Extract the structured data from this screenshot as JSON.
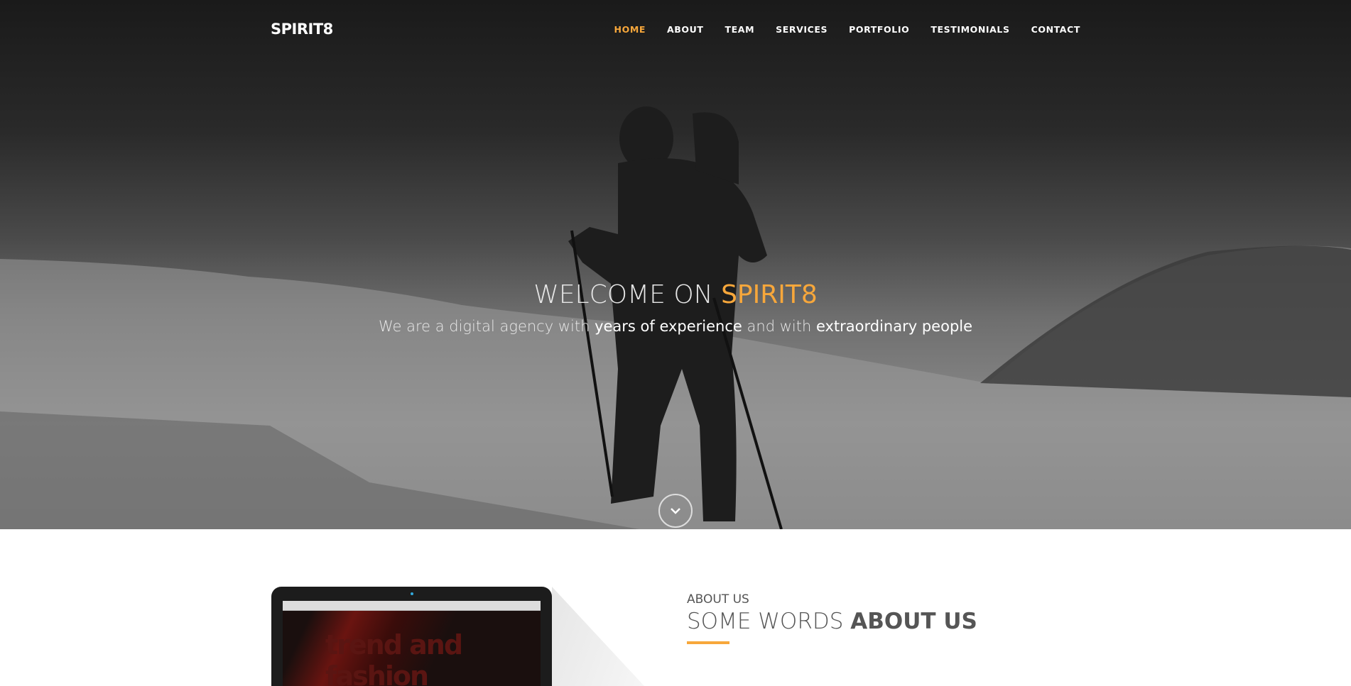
{
  "nav": {
    "logo": "SPIRIT8",
    "items": [
      {
        "label": "HOME",
        "active": true
      },
      {
        "label": "ABOUT"
      },
      {
        "label": "TEAM"
      },
      {
        "label": "SERVICES"
      },
      {
        "label": "PORTFOLIO"
      },
      {
        "label": "TESTIMONIALS"
      },
      {
        "label": "CONTACT"
      }
    ]
  },
  "hero": {
    "title_prefix": "WELCOME ON ",
    "title_highlight": "SPIRIT8",
    "subtitle_1": "We are a digital agency with ",
    "subtitle_bold_1": "years of experience",
    "subtitle_2": " and with ",
    "subtitle_bold_2": "extraordinary people",
    "scroll_icon": "chevron-down-icon"
  },
  "about": {
    "eyebrow": "ABOUT US",
    "heading_light": "SOME WORDS ",
    "heading_bold": "ABOUT US",
    "laptop_screen_text": "trend and fashion"
  },
  "colors": {
    "accent": "#f7a73b",
    "nav_bg": "#1a1a1a"
  }
}
